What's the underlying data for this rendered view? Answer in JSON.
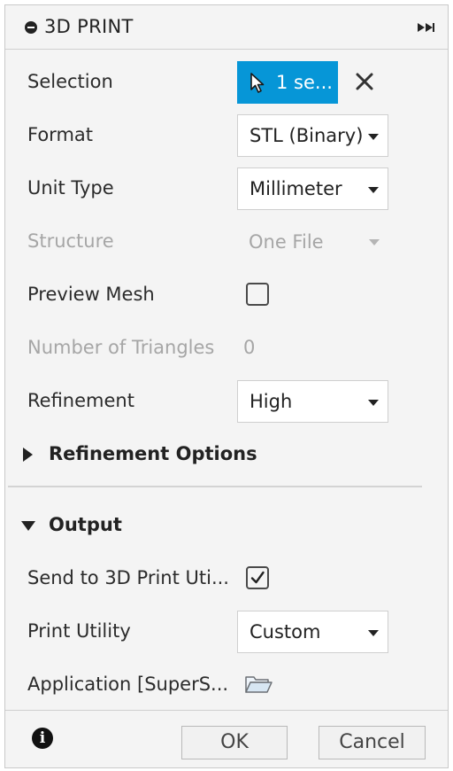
{
  "window": {
    "title": "3D PRINT"
  },
  "fields": {
    "selection": {
      "label": "Selection",
      "value": "1 se..."
    },
    "format": {
      "label": "Format",
      "value": "STL (Binary)"
    },
    "unit_type": {
      "label": "Unit Type",
      "value": "Millimeter"
    },
    "structure": {
      "label": "Structure",
      "value": "One File",
      "disabled": true
    },
    "preview_mesh": {
      "label": "Preview Mesh",
      "checked": false
    },
    "num_triangles": {
      "label": "Number of Triangles",
      "value": "0",
      "disabled": true
    },
    "refinement": {
      "label": "Refinement",
      "value": "High"
    }
  },
  "sections": {
    "refinement_options": {
      "label": "Refinement Options",
      "expanded": false
    },
    "output": {
      "label": "Output",
      "expanded": true
    }
  },
  "output": {
    "send_to_utility": {
      "label": "Send to 3D Print Uti...",
      "checked": true
    },
    "print_utility": {
      "label": "Print Utility",
      "value": "Custom"
    },
    "application": {
      "label": "Application [SuperS..."
    }
  },
  "footer": {
    "ok_label": "OK",
    "cancel_label": "Cancel",
    "info_glyph": "i"
  },
  "colors": {
    "accent": "#0696d7",
    "panel": "#f4f4f4",
    "disabled_text": "#a6a6a6"
  },
  "icons": [
    "collapse-icon",
    "expand-arrows-icon",
    "pointer-icon",
    "close-icon",
    "checkmark-icon",
    "folder-icon",
    "info-icon"
  ]
}
